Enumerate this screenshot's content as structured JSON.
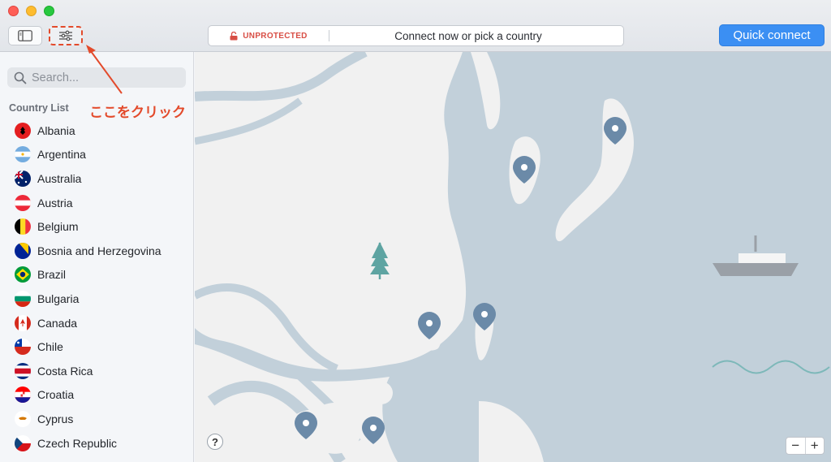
{
  "toolbar": {
    "status_label": "UNPROTECTED",
    "status_message": "Connect now or pick a country",
    "quick_connect_label": "Quick connect"
  },
  "sidebar": {
    "search_placeholder": "Search...",
    "list_header": "Country List",
    "countries": [
      {
        "name": "Albania",
        "flag": "albania"
      },
      {
        "name": "Argentina",
        "flag": "argentina"
      },
      {
        "name": "Australia",
        "flag": "australia"
      },
      {
        "name": "Austria",
        "flag": "austria"
      },
      {
        "name": "Belgium",
        "flag": "belgium"
      },
      {
        "name": "Bosnia and Herzegovina",
        "flag": "bosnia"
      },
      {
        "name": "Brazil",
        "flag": "brazil"
      },
      {
        "name": "Bulgaria",
        "flag": "bulgaria"
      },
      {
        "name": "Canada",
        "flag": "canada"
      },
      {
        "name": "Chile",
        "flag": "chile"
      },
      {
        "name": "Costa Rica",
        "flag": "costa-rica"
      },
      {
        "name": "Croatia",
        "flag": "croatia"
      },
      {
        "name": "Cyprus",
        "flag": "cyprus"
      },
      {
        "name": "Czech Republic",
        "flag": "czech"
      }
    ]
  },
  "map": {
    "help_label": "?",
    "zoom_out_label": "−",
    "zoom_in_label": "+"
  },
  "annotation": {
    "text": "ここをクリック"
  },
  "colors": {
    "accent": "#3b8ff3",
    "unprotected": "#d84e45",
    "annotation": "#e34a2b",
    "water": "#c2d0da",
    "land": "#f1f1f1",
    "pin": "#6b8aa8"
  }
}
